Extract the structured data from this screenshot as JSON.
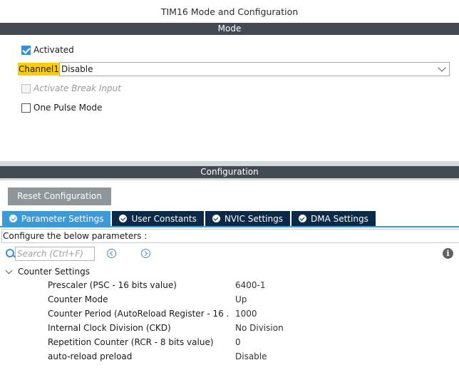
{
  "window": {
    "title": "TIM16 Mode and Configuration"
  },
  "mode": {
    "header": "Mode",
    "activated": {
      "label": "Activated",
      "checked": true
    },
    "channel1": {
      "label": "Channel1",
      "value": "Disable"
    },
    "break_input": {
      "label": "Activate Break Input",
      "checked": false,
      "disabled": true
    },
    "one_pulse": {
      "label": "One Pulse Mode",
      "checked": false
    }
  },
  "configuration": {
    "header": "Configuration",
    "reset_button": "Reset Configuration",
    "tabs": [
      {
        "label": "Parameter Settings",
        "active": true,
        "icon": "check-circle-icon"
      },
      {
        "label": "User Constants",
        "active": false,
        "icon": "check-circle-icon"
      },
      {
        "label": "NVIC Settings",
        "active": false,
        "icon": "check-circle-icon"
      },
      {
        "label": "DMA Settings",
        "active": false,
        "icon": "check-circle-icon"
      }
    ],
    "instructions": "Configure the below parameters :",
    "search": {
      "placeholder": "Search (Ctrl+F)",
      "value": ""
    },
    "info_icon": "i",
    "group": {
      "label": "Counter Settings",
      "params": [
        {
          "name": "Prescaler (PSC - 16 bits value)",
          "value": "6400-1"
        },
        {
          "name": "Counter Mode",
          "value": "Up"
        },
        {
          "name": "Counter Period (AutoReload Register - 16 ...",
          "value": "1000"
        },
        {
          "name": "Internal Clock Division (CKD)",
          "value": "No Division"
        },
        {
          "name": "Repetition Counter (RCR - 8 bits value)",
          "value": "0"
        },
        {
          "name": "auto-reload preload",
          "value": "Disable"
        }
      ]
    }
  },
  "colors": {
    "section_header_bg": "#444a52",
    "active_tab": "#3d9ad8",
    "inactive_tab": "#0b2a4a",
    "channel_highlight": "#ffcc00",
    "reset_button_bg": "#8e959b"
  }
}
